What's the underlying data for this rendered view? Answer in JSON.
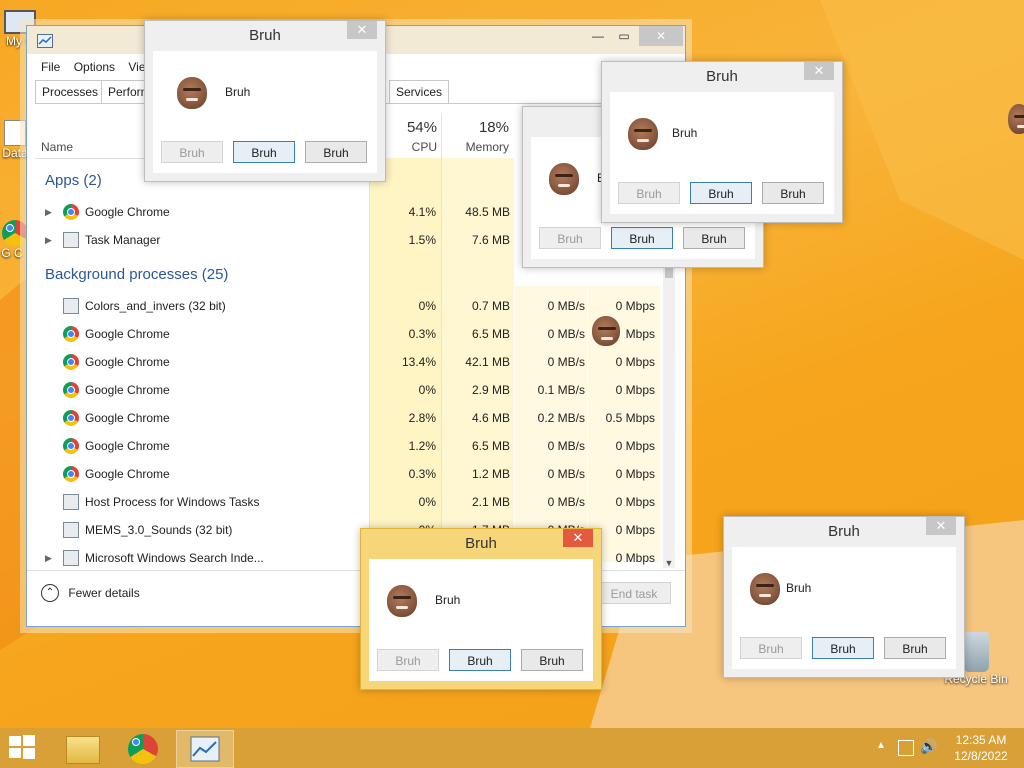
{
  "desktop": {
    "icons": [
      {
        "name": "my-computer",
        "label": "My C"
      },
      {
        "name": "data",
        "label": "Data"
      },
      {
        "name": "google-chrome",
        "label": "G C"
      },
      {
        "name": "recycle-bin",
        "label": "Recycle Bin"
      }
    ]
  },
  "task_manager": {
    "menu": [
      "File",
      "Options",
      "View"
    ],
    "tabs": [
      "Processes",
      "Performance",
      "Services"
    ],
    "columns": {
      "name": "Name",
      "cpu_pct": "54%",
      "cpu": "CPU",
      "mem_pct": "18%",
      "mem": "Memory"
    },
    "apps_header": "Apps (2)",
    "apps": [
      {
        "name": "Google Chrome",
        "cpu": "4.1%",
        "mem": "48.5 MB",
        "icon": "chrome-icon"
      },
      {
        "name": "Task Manager",
        "cpu": "1.5%",
        "mem": "7.6 MB",
        "icon": "task-manager-icon"
      }
    ],
    "bg_header": "Background processes (25)",
    "bg": [
      {
        "name": "Colors_and_invers (32 bit)",
        "cpu": "0%",
        "mem": "0.7 MB",
        "disk": "0 MB/s",
        "net": "0 Mbps",
        "icon": "window-icon"
      },
      {
        "name": "Google Chrome",
        "cpu": "0.3%",
        "mem": "6.5 MB",
        "disk": "0 MB/s",
        "net": "Mbps",
        "icon": "chrome-icon"
      },
      {
        "name": "Google Chrome",
        "cpu": "13.4%",
        "mem": "42.1 MB",
        "disk": "0 MB/s",
        "net": "0 Mbps",
        "icon": "chrome-icon"
      },
      {
        "name": "Google Chrome",
        "cpu": "0%",
        "mem": "2.9 MB",
        "disk": "0.1 MB/s",
        "net": "0 Mbps",
        "icon": "chrome-icon"
      },
      {
        "name": "Google Chrome",
        "cpu": "2.8%",
        "mem": "4.6 MB",
        "disk": "0.2 MB/s",
        "net": "0.5 Mbps",
        "icon": "chrome-icon"
      },
      {
        "name": "Google Chrome",
        "cpu": "1.2%",
        "mem": "6.5 MB",
        "disk": "0 MB/s",
        "net": "0 Mbps",
        "icon": "chrome-icon"
      },
      {
        "name": "Google Chrome",
        "cpu": "0.3%",
        "mem": "1.2 MB",
        "disk": "0 MB/s",
        "net": "0 Mbps",
        "icon": "chrome-icon"
      },
      {
        "name": "Host Process for Windows Tasks",
        "cpu": "0%",
        "mem": "2.1 MB",
        "disk": "0 MB/s",
        "net": "0 Mbps",
        "icon": "window-icon"
      },
      {
        "name": "MEMS_3.0_Sounds (32 bit)",
        "cpu": "0%",
        "mem": "1.7 MB",
        "disk": "0 MB/s",
        "net": "0 Mbps",
        "icon": "sound-icon"
      },
      {
        "name": "Microsoft Windows Search Inde...",
        "cpu": "",
        "mem": "",
        "disk": "",
        "net": "0 Mbps",
        "icon": "search-indexer-icon"
      }
    ],
    "fewer_details": "Fewer details",
    "end_task": "End task"
  },
  "dialogs": {
    "title": "Bruh",
    "message": "Bruh",
    "btn": "Bruh",
    "partial_message": "B"
  },
  "taskbar": {
    "time": "12:35 AM",
    "date": "12/8/2022"
  }
}
